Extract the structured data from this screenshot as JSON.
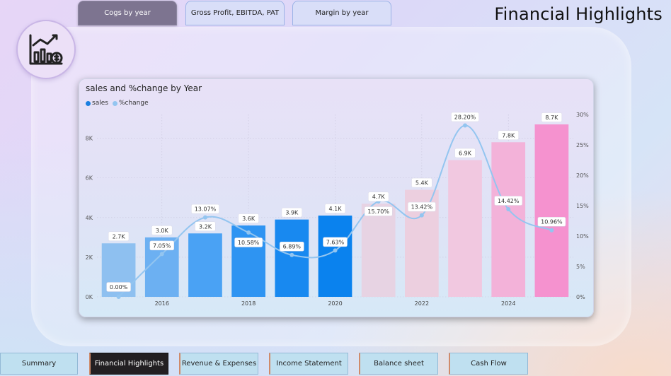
{
  "page_title": "Financial Highlights",
  "top_tabs": [
    {
      "label": "Cogs by year",
      "active": true
    },
    {
      "label": "Gross Profit, EBITDA, PAT",
      "active": false
    },
    {
      "label": "Margin by year",
      "active": false
    }
  ],
  "logo_icon": "finance-chart-icon",
  "bottom_tabs": [
    {
      "label": "Summary",
      "active": false
    },
    {
      "label": "Financial Highlights",
      "active": true
    },
    {
      "label": "Revenue & Expenses",
      "active": false
    },
    {
      "label": "Income Statement",
      "active": false
    },
    {
      "label": "Balance sheet",
      "active": false
    },
    {
      "label": "Cash Flow",
      "active": false
    }
  ],
  "chart_data": {
    "type": "bar",
    "title": "sales and %change by Year",
    "x": [
      2015,
      2016,
      2017,
      2018,
      2019,
      2020,
      2021,
      2022,
      2023,
      2024,
      2025
    ],
    "x_tick_labels": [
      "2016",
      "2018",
      "2020",
      "2022",
      "2024"
    ],
    "series": [
      {
        "name": "sales",
        "type": "bar",
        "axis": "left",
        "values": [
          2700,
          3000,
          3200,
          3600,
          3900,
          4100,
          4700,
          5400,
          6900,
          7800,
          8700
        ],
        "labels": [
          "2.7K",
          "3.0K",
          "3.2K",
          "3.6K",
          "3.9K",
          "4.1K",
          "4.7K",
          "5.4K",
          "6.9K",
          "7.8K",
          "8.7K"
        ],
        "colors": [
          "#8ec0f0",
          "#6cb0f2",
          "#4aa2f4",
          "#2e94f2",
          "#1889f0",
          "#0a82ee",
          "#e7d3e3",
          "#eccfdf",
          "#f1c8e0",
          "#f3b2d9",
          "#f592cf"
        ]
      },
      {
        "name": "%change",
        "type": "line",
        "axis": "right",
        "values": [
          0.0,
          7.05,
          13.07,
          10.58,
          6.89,
          7.63,
          15.7,
          13.42,
          28.2,
          14.42,
          10.96
        ],
        "labels": [
          "0.00%",
          "7.05%",
          "13.07%",
          "10.58%",
          "6.89%",
          "7.63%",
          "15.70%",
          "13.42%",
          "28.20%",
          "14.42%",
          "10.96%"
        ],
        "color": "#93c5f0"
      }
    ],
    "y_left": {
      "ticks": [
        0,
        2000,
        4000,
        6000,
        8000
      ],
      "tick_labels": [
        "0K",
        "2K",
        "4K",
        "6K",
        "8K"
      ],
      "range": [
        0,
        9200
      ]
    },
    "y_right": {
      "ticks": [
        0,
        5,
        10,
        15,
        20,
        25,
        30
      ],
      "tick_labels": [
        "0%",
        "5%",
        "10%",
        "15%",
        "20%",
        "25%",
        "30%"
      ],
      "range": [
        0,
        30
      ]
    },
    "legend": [
      {
        "name": "sales",
        "color": "#1a7fe0"
      },
      {
        "name": "%change",
        "color": "#93c5f0"
      }
    ],
    "legend_position": "top-left",
    "grid": true
  }
}
